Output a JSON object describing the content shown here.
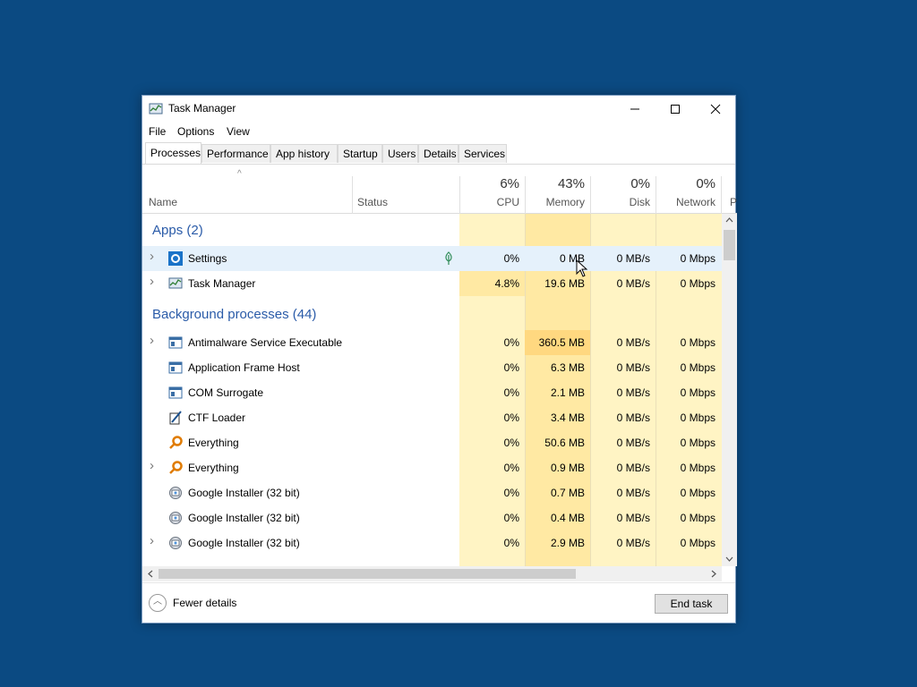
{
  "window": {
    "title": "Task Manager",
    "menu": [
      "File",
      "Options",
      "View"
    ],
    "tabs": [
      "Processes",
      "Performance",
      "App history",
      "Startup",
      "Users",
      "Details",
      "Services"
    ],
    "active_tab": "Processes"
  },
  "columns": {
    "sort_indicator": "^",
    "name": "Name",
    "status": "Status",
    "cpu": {
      "percent": "6%",
      "label": "CPU"
    },
    "memory": {
      "percent": "43%",
      "label": "Memory"
    },
    "disk": {
      "percent": "0%",
      "label": "Disk"
    },
    "network": {
      "percent": "0%",
      "label": "Network"
    },
    "power_partial": "P"
  },
  "groups": {
    "apps": "Apps (2)",
    "background": "Background processes (44)"
  },
  "apps": [
    {
      "name": "Settings",
      "expandable": true,
      "icon": "settings-icon",
      "suspended": true,
      "cpu": "0%",
      "memory": "0 MB",
      "disk": "0 MB/s",
      "network": "0 Mbps",
      "selected": true
    },
    {
      "name": "Task Manager",
      "expandable": true,
      "icon": "task-manager-icon",
      "cpu": "4.8%",
      "memory": "19.6 MB",
      "disk": "0 MB/s",
      "network": "0 Mbps"
    }
  ],
  "background": [
    {
      "name": "Antimalware Service Executable",
      "expandable": true,
      "icon": "window-app-icon",
      "cpu": "0%",
      "memory": "360.5 MB",
      "disk": "0 MB/s",
      "network": "0 Mbps"
    },
    {
      "name": "Application Frame Host",
      "expandable": false,
      "icon": "window-app-icon",
      "cpu": "0%",
      "memory": "6.3 MB",
      "disk": "0 MB/s",
      "network": "0 Mbps"
    },
    {
      "name": "COM Surrogate",
      "expandable": false,
      "icon": "window-app-icon",
      "cpu": "0%",
      "memory": "2.1 MB",
      "disk": "0 MB/s",
      "network": "0 Mbps"
    },
    {
      "name": "CTF Loader",
      "expandable": false,
      "icon": "pen-note-icon",
      "cpu": "0%",
      "memory": "3.4 MB",
      "disk": "0 MB/s",
      "network": "0 Mbps"
    },
    {
      "name": "Everything",
      "expandable": false,
      "icon": "magnifier-icon",
      "cpu": "0%",
      "memory": "50.6 MB",
      "disk": "0 MB/s",
      "network": "0 Mbps"
    },
    {
      "name": "Everything",
      "expandable": true,
      "icon": "magnifier-icon",
      "cpu": "0%",
      "memory": "0.9 MB",
      "disk": "0 MB/s",
      "network": "0 Mbps"
    },
    {
      "name": "Google Installer (32 bit)",
      "expandable": false,
      "icon": "installer-icon",
      "cpu": "0%",
      "memory": "0.7 MB",
      "disk": "0 MB/s",
      "network": "0 Mbps"
    },
    {
      "name": "Google Installer (32 bit)",
      "expandable": false,
      "icon": "installer-icon",
      "cpu": "0%",
      "memory": "0.4 MB",
      "disk": "0 MB/s",
      "network": "0 Mbps"
    },
    {
      "name": "Google Installer (32 bit)",
      "expandable": true,
      "icon": "installer-icon",
      "cpu": "0%",
      "memory": "2.9 MB",
      "disk": "0 MB/s",
      "network": "0 Mbps"
    }
  ],
  "footer": {
    "fewer_details": "Fewer details",
    "end_task": "End task"
  },
  "colors": {
    "desktop": "#0b4a82",
    "group_text": "#2a5ba8",
    "heat_light": "#fff4c4",
    "heat_medium": "#ffe9a3",
    "heat_strong": "#ffd880",
    "selected_row": "#e5f1fb"
  }
}
